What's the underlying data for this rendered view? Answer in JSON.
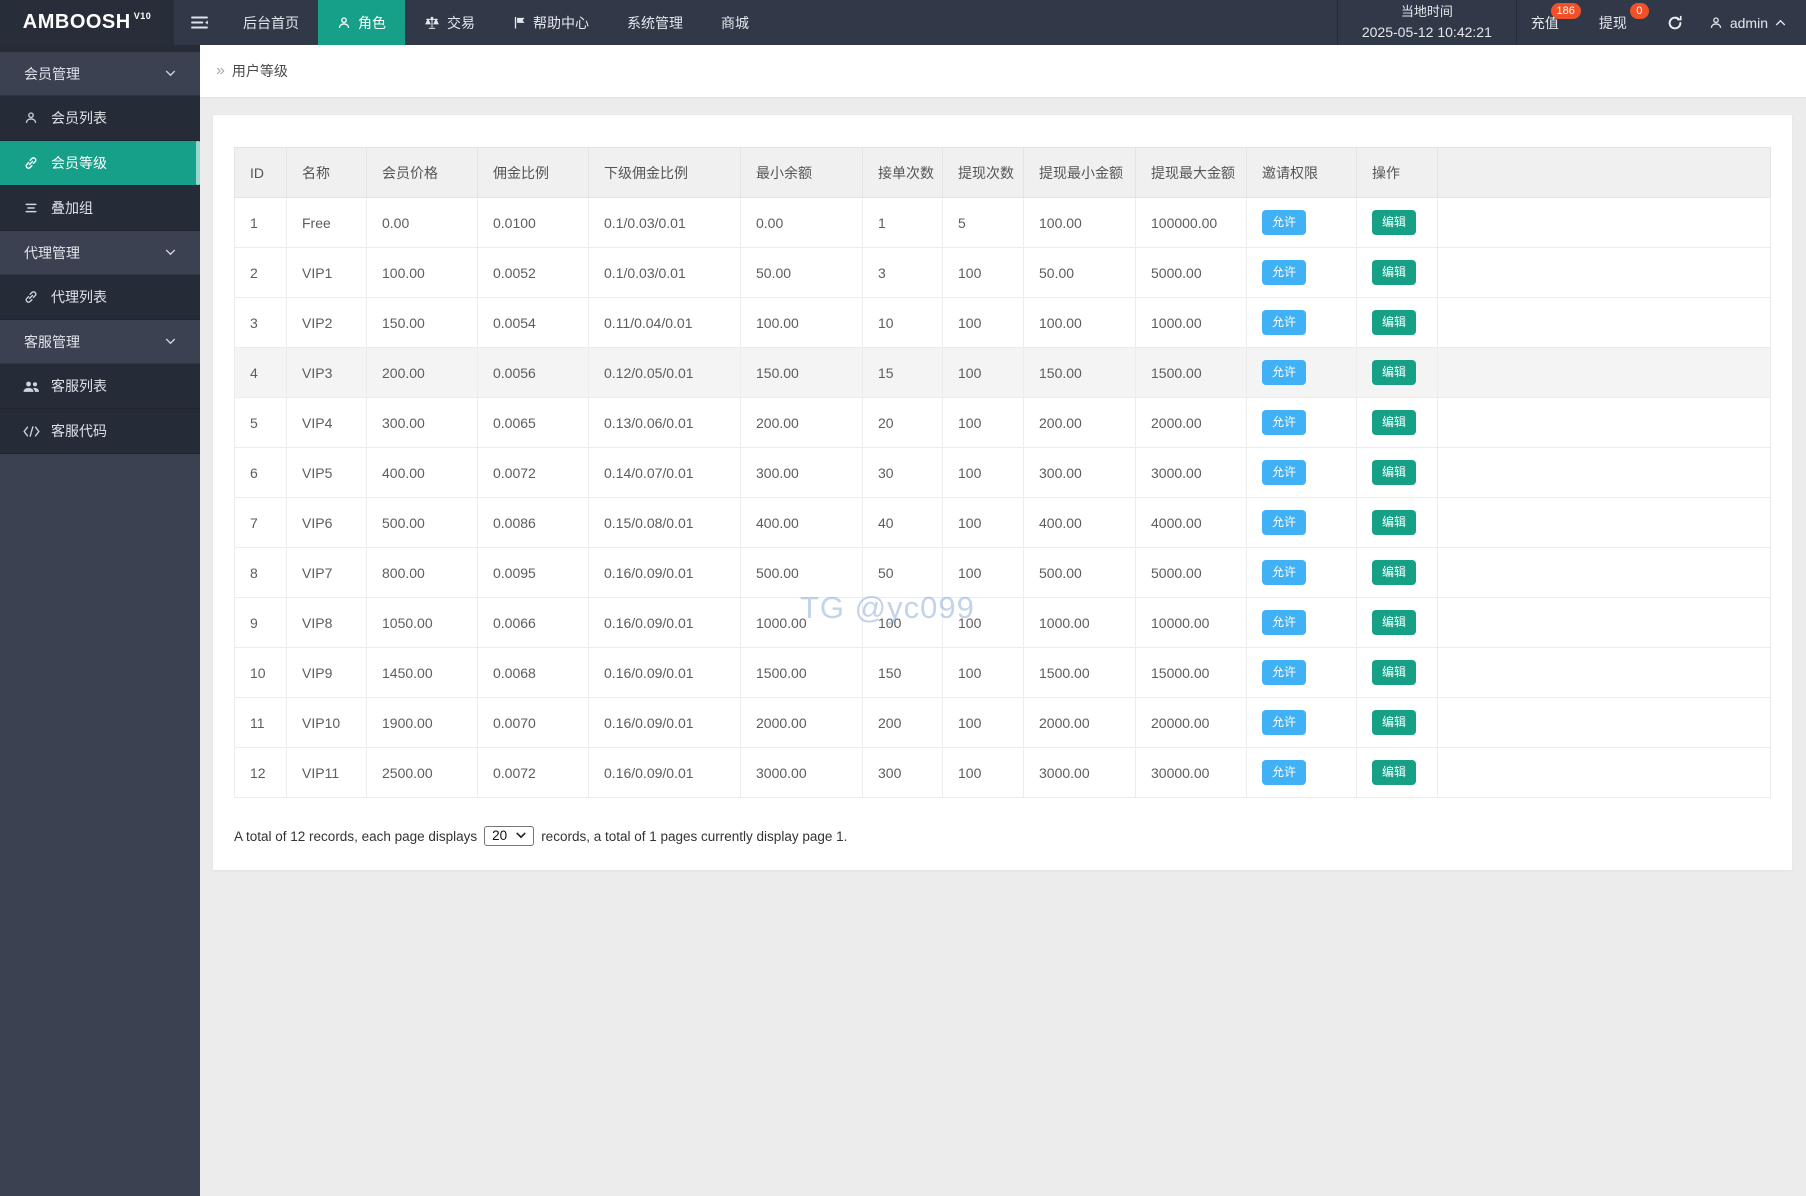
{
  "navbar": {
    "logo": "AMBOOSH",
    "logo_sup": "V10",
    "items": [
      {
        "label": "后台首页",
        "icon": null,
        "active": false
      },
      {
        "label": "角色",
        "icon": "person",
        "active": true
      },
      {
        "label": "交易",
        "icon": "scales",
        "active": false
      },
      {
        "label": "帮助中心",
        "icon": "flag",
        "active": false
      },
      {
        "label": "系统管理",
        "icon": null,
        "active": false
      },
      {
        "label": "商城",
        "icon": null,
        "active": false
      }
    ],
    "local_time_label": "当地时间",
    "local_time_value": "2025-05-12 10:42:21",
    "recharge_label": "充值",
    "recharge_badge": "186",
    "withdraw_label": "提现",
    "withdraw_badge": "0",
    "username": "admin"
  },
  "sidebar": {
    "items": [
      {
        "type": "header",
        "label": "会员管理",
        "icon": "chevron-down"
      },
      {
        "type": "item",
        "label": "会员列表",
        "icon": "user",
        "active": false
      },
      {
        "type": "item",
        "label": "会员等级",
        "icon": "link",
        "active": true
      },
      {
        "type": "item",
        "label": "叠加组",
        "icon": "list",
        "active": false
      },
      {
        "type": "header",
        "label": "代理管理",
        "icon": "chevron-down"
      },
      {
        "type": "item",
        "label": "代理列表",
        "icon": "link",
        "active": false
      },
      {
        "type": "header",
        "label": "客服管理",
        "icon": "chevron-down"
      },
      {
        "type": "item",
        "label": "客服列表",
        "icon": "users",
        "active": false
      },
      {
        "type": "item",
        "label": "客服代码",
        "icon": "code",
        "active": false
      }
    ]
  },
  "breadcrumb": {
    "title": "用户等级"
  },
  "table": {
    "columns": [
      "ID",
      "名称",
      "会员价格",
      "佣金比例",
      "下级佣金比例",
      "最小余额",
      "接单次数",
      "提现次数",
      "提现最小金额",
      "提现最大金额",
      "邀请权限",
      "操作"
    ],
    "allow_label": "允许",
    "edit_label": "编辑",
    "highlight_row_index": 3,
    "rows": [
      [
        "1",
        "Free",
        "0.00",
        "0.0100",
        "0.1/0.03/0.01",
        "0.00",
        "1",
        "5",
        "100.00",
        "100000.00"
      ],
      [
        "2",
        "VIP1",
        "100.00",
        "0.0052",
        "0.1/0.03/0.01",
        "50.00",
        "3",
        "100",
        "50.00",
        "5000.00"
      ],
      [
        "3",
        "VIP2",
        "150.00",
        "0.0054",
        "0.11/0.04/0.01",
        "100.00",
        "10",
        "100",
        "100.00",
        "1000.00"
      ],
      [
        "4",
        "VIP3",
        "200.00",
        "0.0056",
        "0.12/0.05/0.01",
        "150.00",
        "15",
        "100",
        "150.00",
        "1500.00"
      ],
      [
        "5",
        "VIP4",
        "300.00",
        "0.0065",
        "0.13/0.06/0.01",
        "200.00",
        "20",
        "100",
        "200.00",
        "2000.00"
      ],
      [
        "6",
        "VIP5",
        "400.00",
        "0.0072",
        "0.14/0.07/0.01",
        "300.00",
        "30",
        "100",
        "300.00",
        "3000.00"
      ],
      [
        "7",
        "VIP6",
        "500.00",
        "0.0086",
        "0.15/0.08/0.01",
        "400.00",
        "40",
        "100",
        "400.00",
        "4000.00"
      ],
      [
        "8",
        "VIP7",
        "800.00",
        "0.0095",
        "0.16/0.09/0.01",
        "500.00",
        "50",
        "100",
        "500.00",
        "5000.00"
      ],
      [
        "9",
        "VIP8",
        "1050.00",
        "0.0066",
        "0.16/0.09/0.01",
        "1000.00",
        "100",
        "100",
        "1000.00",
        "10000.00"
      ],
      [
        "10",
        "VIP9",
        "1450.00",
        "0.0068",
        "0.16/0.09/0.01",
        "1500.00",
        "150",
        "100",
        "1500.00",
        "15000.00"
      ],
      [
        "11",
        "VIP10",
        "1900.00",
        "0.0070",
        "0.16/0.09/0.01",
        "2000.00",
        "200",
        "100",
        "2000.00",
        "20000.00"
      ],
      [
        "12",
        "VIP11",
        "2500.00",
        "0.0072",
        "0.16/0.09/0.01",
        "3000.00",
        "300",
        "100",
        "3000.00",
        "30000.00"
      ]
    ]
  },
  "pagination": {
    "prefix": "A total of 12 records, each page displays",
    "page_size": "20",
    "suffix": "records, a total of 1 pages currently display page 1."
  },
  "watermark": "TG @yc099",
  "colors": {
    "accent": "#16a089",
    "allow_blue": "#41b1f5",
    "edit_green": "#16a085",
    "badge_orange": "#f0512a"
  }
}
